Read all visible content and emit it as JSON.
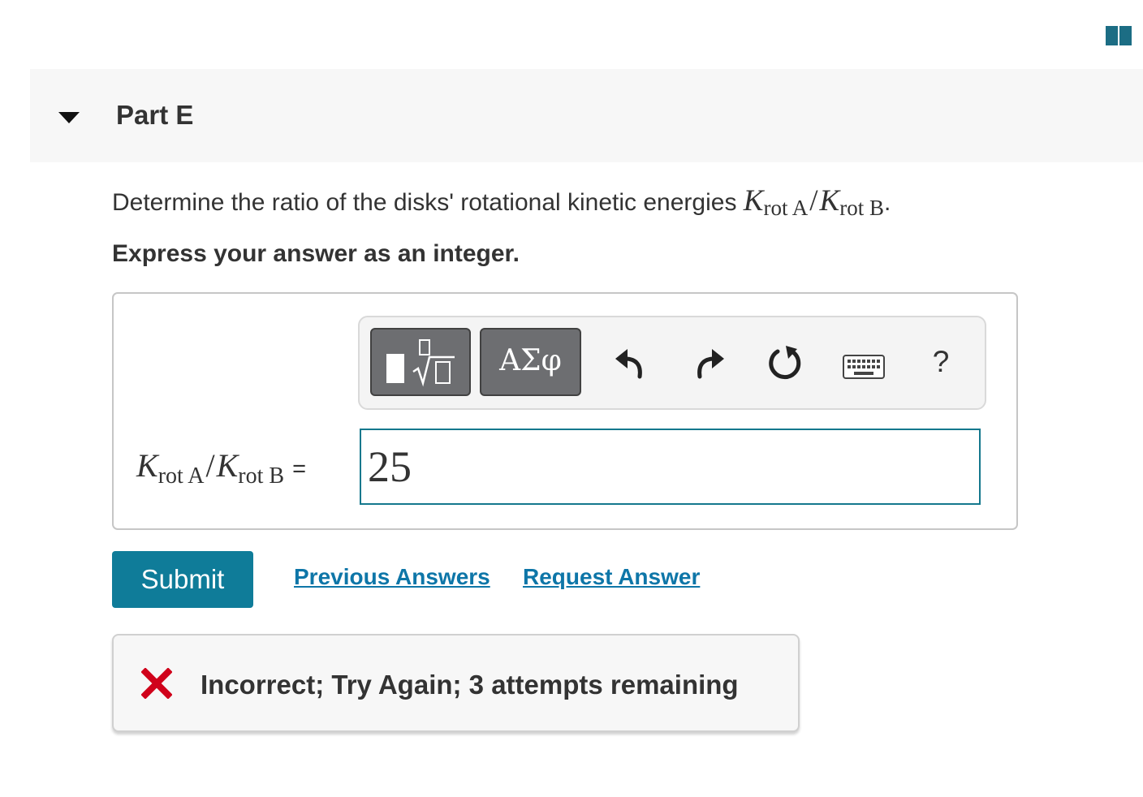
{
  "part": {
    "title": "Part E"
  },
  "question": {
    "prompt": "Determine the ratio of the disks' rotational kinetic energies ",
    "symbol_K": "K",
    "sub_a": "rot A",
    "sub_b": "rot B",
    "slash": "/",
    "period": "."
  },
  "instruction": "Express your answer as an integer.",
  "toolbar": {
    "greek_label": "ΑΣφ",
    "help_label": "?",
    "icons": [
      "templates-icon",
      "greek-letters-icon",
      "undo-icon",
      "redo-icon",
      "reset-icon",
      "keyboard-icon",
      "help-icon"
    ]
  },
  "answer": {
    "equals": "=",
    "value": "25"
  },
  "actions": {
    "submit_label": "Submit",
    "previous_answers_label": "Previous Answers",
    "request_answer_label": "Request Answer"
  },
  "feedback": {
    "message": "Incorrect; Try Again; 3 attempts remaining"
  },
  "colors": {
    "accent": "#0f7c99",
    "link": "#0e76a8",
    "error": "#d0021b",
    "input_border": "#14788d",
    "book_icon": "#1c6d84"
  }
}
